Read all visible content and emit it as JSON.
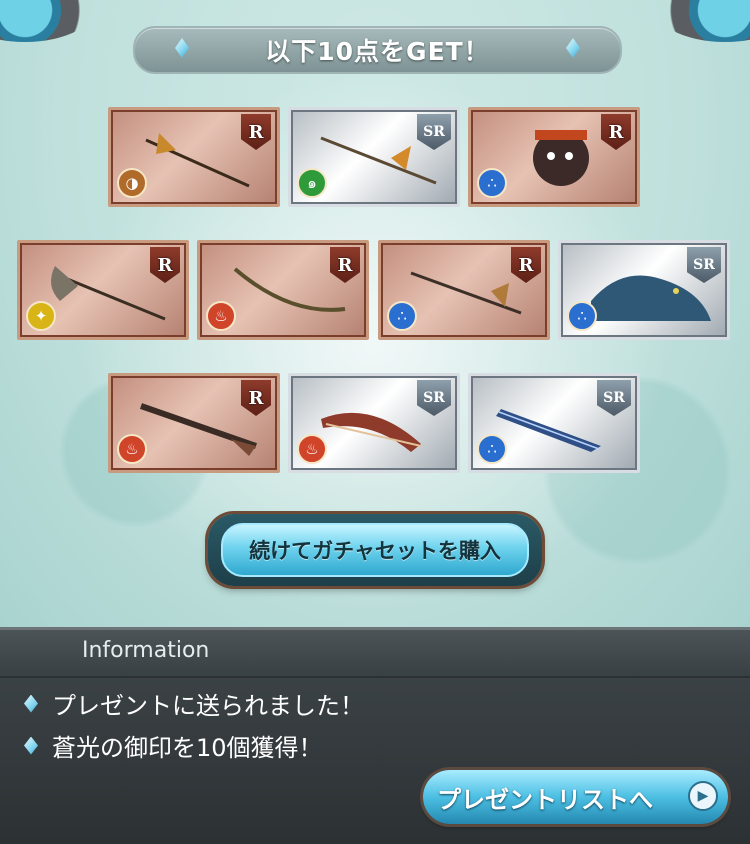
{
  "header": {
    "title": "以下10点をGET！"
  },
  "items": [
    {
      "rarity": "R",
      "element": "earth",
      "element_color": "#b06a2a",
      "element_glyph": "◑",
      "icon": "halberd-icon"
    },
    {
      "rarity": "SR",
      "element": "wind",
      "element_color": "#2f9a3a",
      "element_glyph": "๑",
      "icon": "spear-icon"
    },
    {
      "rarity": "R",
      "element": "water",
      "element_color": "#2a6fd0",
      "element_glyph": "∴",
      "icon": "moogle-summon-icon"
    },
    {
      "rarity": "R",
      "element": "light",
      "element_color": "#d8b417",
      "element_glyph": "✦",
      "icon": "axe-icon"
    },
    {
      "rarity": "R",
      "element": "fire",
      "element_color": "#d0442a",
      "element_glyph": "♨",
      "icon": "bow-icon"
    },
    {
      "rarity": "R",
      "element": "water",
      "element_color": "#2a6fd0",
      "element_glyph": "∴",
      "icon": "dagger-icon"
    },
    {
      "rarity": "SR",
      "element": "water",
      "element_color": "#2a6fd0",
      "element_glyph": "∴",
      "icon": "dragon-summon-icon"
    },
    {
      "rarity": "R",
      "element": "fire",
      "element_color": "#d0442a",
      "element_glyph": "♨",
      "icon": "gun-icon"
    },
    {
      "rarity": "SR",
      "element": "fire",
      "element_color": "#d0442a",
      "element_glyph": "♨",
      "icon": "blade-icon"
    },
    {
      "rarity": "SR",
      "element": "water",
      "element_color": "#2a6fd0",
      "element_glyph": "∴",
      "icon": "sword-icon"
    }
  ],
  "actions": {
    "buy_label": "続けてガチャセットを購入"
  },
  "info": {
    "title": "Information",
    "messages": [
      "プレゼントに送られました！",
      "蒼光の御印を10個獲得！"
    ],
    "present_button_label": "プレゼントリストへ"
  }
}
